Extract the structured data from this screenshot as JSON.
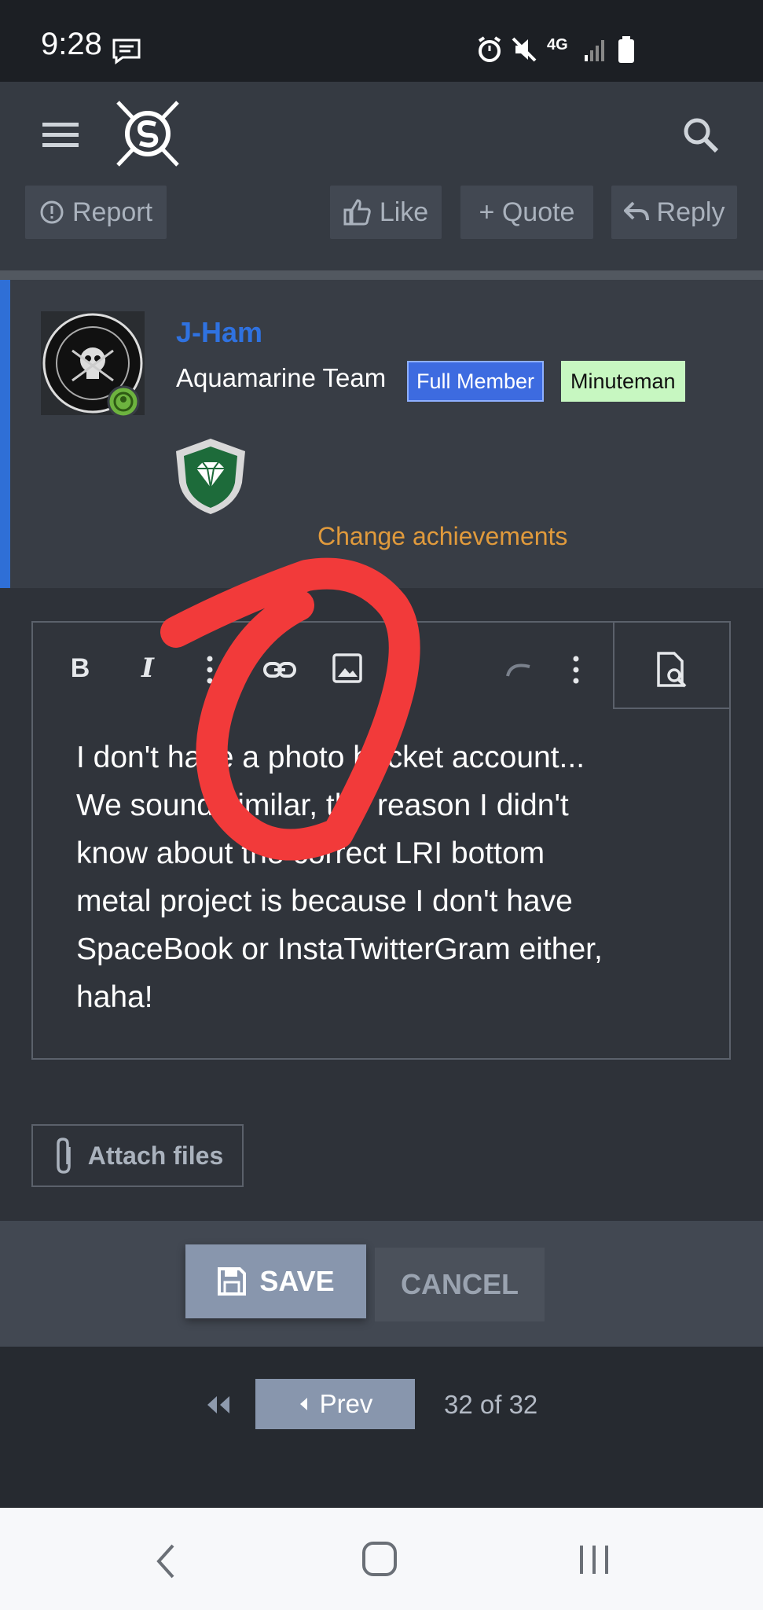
{
  "status_bar": {
    "time": "9:28",
    "network": "4G"
  },
  "header": {
    "menu_icon": "hamburger-icon",
    "logo": "scout-sniper-logo",
    "search_icon": "search-icon"
  },
  "post_actions": {
    "report": "Report",
    "like": "Like",
    "quote": "+ Quote",
    "reply": "Reply"
  },
  "user": {
    "name": "J-Ham",
    "team": "Aquamarine Team",
    "badges": [
      "Full Member",
      "Minuteman"
    ],
    "achievements_link": "Change achievements"
  },
  "editor": {
    "text": "I don't have a photo bucket account...\nWe sound similar, the reason I didn't\nknow about the correct LRI bottom\nmetal project is because I don't have\nSpaceBook or InstaTwitterGram either,\nhaha!",
    "toolbar": [
      "bold",
      "italic",
      "more",
      "link",
      "image",
      "more",
      "undo",
      "more",
      "preview"
    ]
  },
  "attach": {
    "label": "Attach files"
  },
  "form_buttons": {
    "save": "SAVE",
    "cancel": "CANCEL"
  },
  "pagination": {
    "prev": "Prev",
    "count": "32 of 32"
  },
  "colors": {
    "accent": "#2f72e0",
    "link": "#e09a3c",
    "annotation": "#f23a3a"
  }
}
